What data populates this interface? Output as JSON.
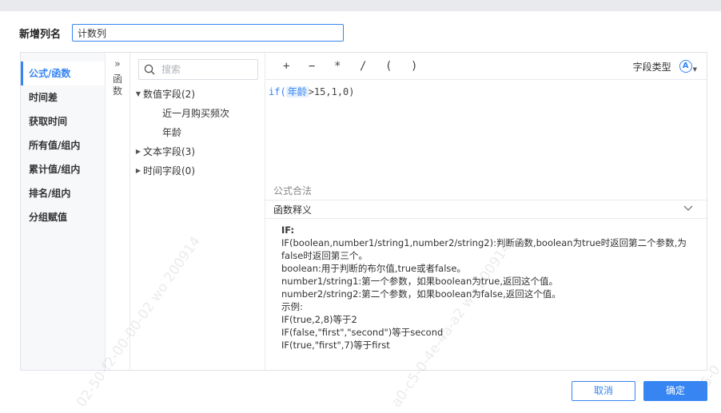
{
  "dialog": {
    "name_label": "新增列名",
    "name_value": "计数列"
  },
  "categories": [
    {
      "label": "公式/函数",
      "active": true
    },
    {
      "label": "时间差",
      "active": false
    },
    {
      "label": "获取时间",
      "active": false
    },
    {
      "label": "所有值/组内",
      "active": false
    },
    {
      "label": "累计值/组内",
      "active": false
    },
    {
      "label": "排名/组内",
      "active": false
    },
    {
      "label": "分组赋值",
      "active": false
    }
  ],
  "collapse": {
    "chevron": "»",
    "text": "函数"
  },
  "field_panel": {
    "search_placeholder": "搜索",
    "groups": [
      {
        "label": "数值字段(2)",
        "expanded": true,
        "children": [
          "近一月购买频次",
          "年龄"
        ]
      },
      {
        "label": "文本字段(3)",
        "expanded": false,
        "children": []
      },
      {
        "label": "时间字段(0)",
        "expanded": false,
        "children": []
      }
    ]
  },
  "toolbar": {
    "operators": [
      "+",
      "−",
      "*",
      "/",
      "(",
      ")"
    ],
    "field_type_label": "字段类型",
    "field_type_icon": "A"
  },
  "formula": {
    "prefix": "if(",
    "field": "年龄",
    "suffix": ">15,1,0)",
    "valid_label": "公式合法"
  },
  "description": {
    "title": "函数释义",
    "function_name": "IF:",
    "lines": [
      "IF(boolean,number1/string1,number2/string2):判断函数,boolean为true时返回第二个参数,为false时返回第三个。",
      "boolean:用于判断的布尔值,true或者false。",
      "number1/string1:第一个参数，如果boolean为true,返回这个值。",
      "number2/string2:第二个参数，如果boolean为false,返回这个值。",
      "示例:",
      "IF(true,2,8)等于2",
      "IF(false,\"first\",\"second\")等于second",
      "IF(true,\"first\",7)等于first"
    ]
  },
  "buttons": {
    "cancel": "取消",
    "ok": "确定"
  },
  "watermarks": [
    "02-50-f2-00-00-02 wo 200914",
    "a0-c5-0-4e-4a-a2 wo 200914",
    "c5-0"
  ],
  "colors": {
    "accent": "#3685f2"
  }
}
